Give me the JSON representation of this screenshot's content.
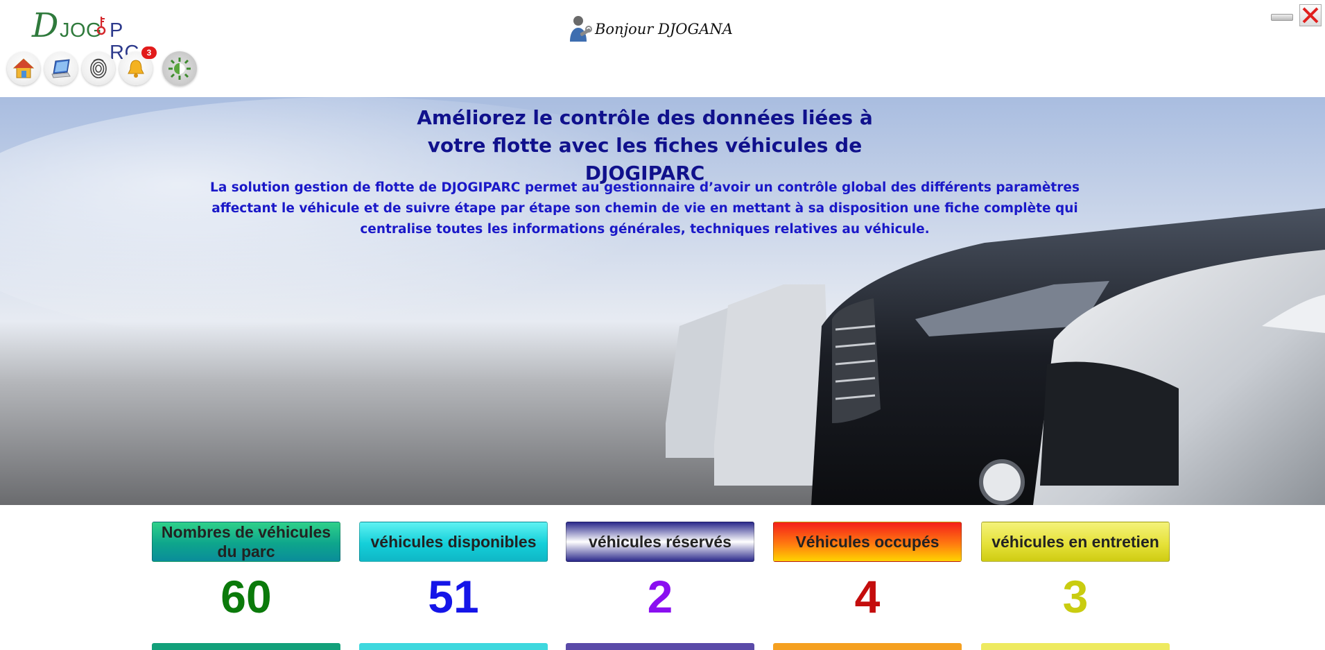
{
  "app": {
    "logo_text_d": "D",
    "logo_text_jog": "JOG",
    "logo_text_parc": "P RC",
    "greeting": "Bonjour DJOGANA",
    "notification_count": "3"
  },
  "toolbar": {
    "icons": [
      "home-icon",
      "laptop-icon",
      "fingerprint-icon",
      "bell-icon",
      "sun-settings-icon"
    ]
  },
  "hero": {
    "title": "Améliorez le contrôle des données liées à votre flotte avec les fiches véhicules de DJOGIPARC",
    "description": "La solution gestion de flotte de DJOGIPARC permet au gestionnaire d’avoir un contrôle global des différents paramètres affectant le véhicule et de suivre étape par étape son chemin de vie en mettant à sa disposition une fiche complète qui centralise toutes les informations générales, techniques relatives au véhicule."
  },
  "stats": [
    {
      "label": "Nombres de véhicules du parc",
      "value": "60",
      "color": "#0b7a0b"
    },
    {
      "label": "véhicules disponibles",
      "value": "51",
      "color": "#1515e8"
    },
    {
      "label": "véhicules réservés",
      "value": "2",
      "color": "#8a0ff0"
    },
    {
      "label": "Véhicules occupés",
      "value": "4",
      "color": "#c40d0d"
    },
    {
      "label": "véhicules en entretien",
      "value": "3",
      "color": "#c9cc10"
    }
  ]
}
